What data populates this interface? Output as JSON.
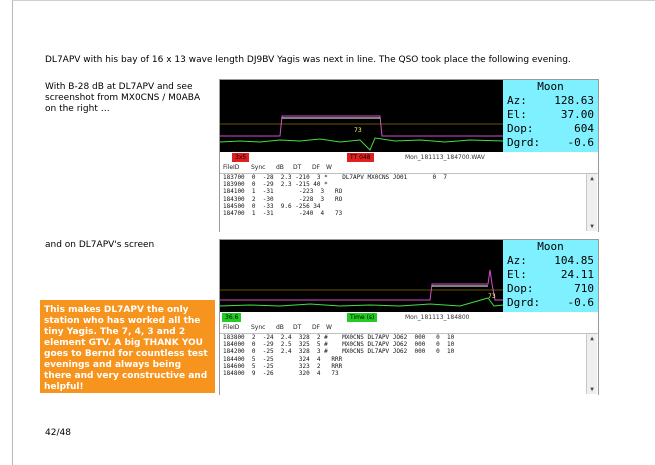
{
  "headline": "DL7APV with his bay of 16 x 13 wave length DJ9BV Yagis was next in line. The QSO took place the following evening.",
  "intro": [
    "With B-28 dB at DL7APV and see",
    "screenshot from MX0CNS / M0ABA",
    "on the right …"
  ],
  "second_caption": "and on DL7APV's screen",
  "callout": "This makes DL7APV the only station who has worked all the tiny Yagis. The 7, 4, 3 and 2 element GTV. A big THANK YOU goes to Bernd for countless test evenings and always being there and very constructive and helpful!",
  "page_number": "42/48",
  "colors": {
    "callout_bg": "#f7941d",
    "moon_bg": "#7ff0ff",
    "tag_red": "#e02020",
    "tag_green": "#22cc22"
  },
  "shot1": {
    "moon": {
      "title": "Moon",
      "rows": [
        {
          "k": "Az:",
          "v": "128.63"
        },
        {
          "k": "El:",
          "v": "37.00"
        },
        {
          "k": "Dop:",
          "v": "604"
        },
        {
          "k": "Dgrd:",
          "v": "-0.6"
        }
      ]
    },
    "wf_label": "73",
    "tag_left": "3x5",
    "tag_right": "TT 048",
    "file_label": "Mon_181113_184700.WAV",
    "headers": [
      "FileID",
      "Sync",
      "dB",
      "DT",
      "DF",
      "W"
    ],
    "rows": [
      "183700  0  -28  2.3 -210  3 *    DL7APV MX0CNS JO01       0  7",
      "183900  0  -29  2.3 -215 40 *",
      "184100  1  -31       -223  3   RO",
      "184300  2  -30       -228  3   RO",
      "184500  0  -33  9.6 -256 34",
      "184700  1  -31       -240  4   73"
    ]
  },
  "shot2": {
    "moon": {
      "title": "Moon",
      "rows": [
        {
          "k": "Az:",
          "v": "104.85"
        },
        {
          "k": "El:",
          "v": "24.11"
        },
        {
          "k": "Dop:",
          "v": "710"
        },
        {
          "k": "Dgrd:",
          "v": "-0.6"
        }
      ]
    },
    "wf_label": "73",
    "tag_left": "36.6",
    "tag_right": "Time (s)",
    "file_label": "Mon_181113_184800",
    "headers": [
      "FileID",
      "Sync",
      "dB",
      "DT",
      "DF",
      "W"
    ],
    "rows": [
      "183800  2  -24  2.4  328  2 #    MX0CNS DL7APV JO62  000   0  10",
      "184000  0  -29  2.5  325  5 #    MX0CNS DL7APV JO62  000   0  10",
      "184200  0  -25  2.4  328  3 #    MX0CNS DL7APV JO62  000   0  10",
      "184400  5  -25       324  4   RRR",
      "184600  5  -25       323  2   RRR",
      "184800  9  -26       320  4   73"
    ]
  }
}
